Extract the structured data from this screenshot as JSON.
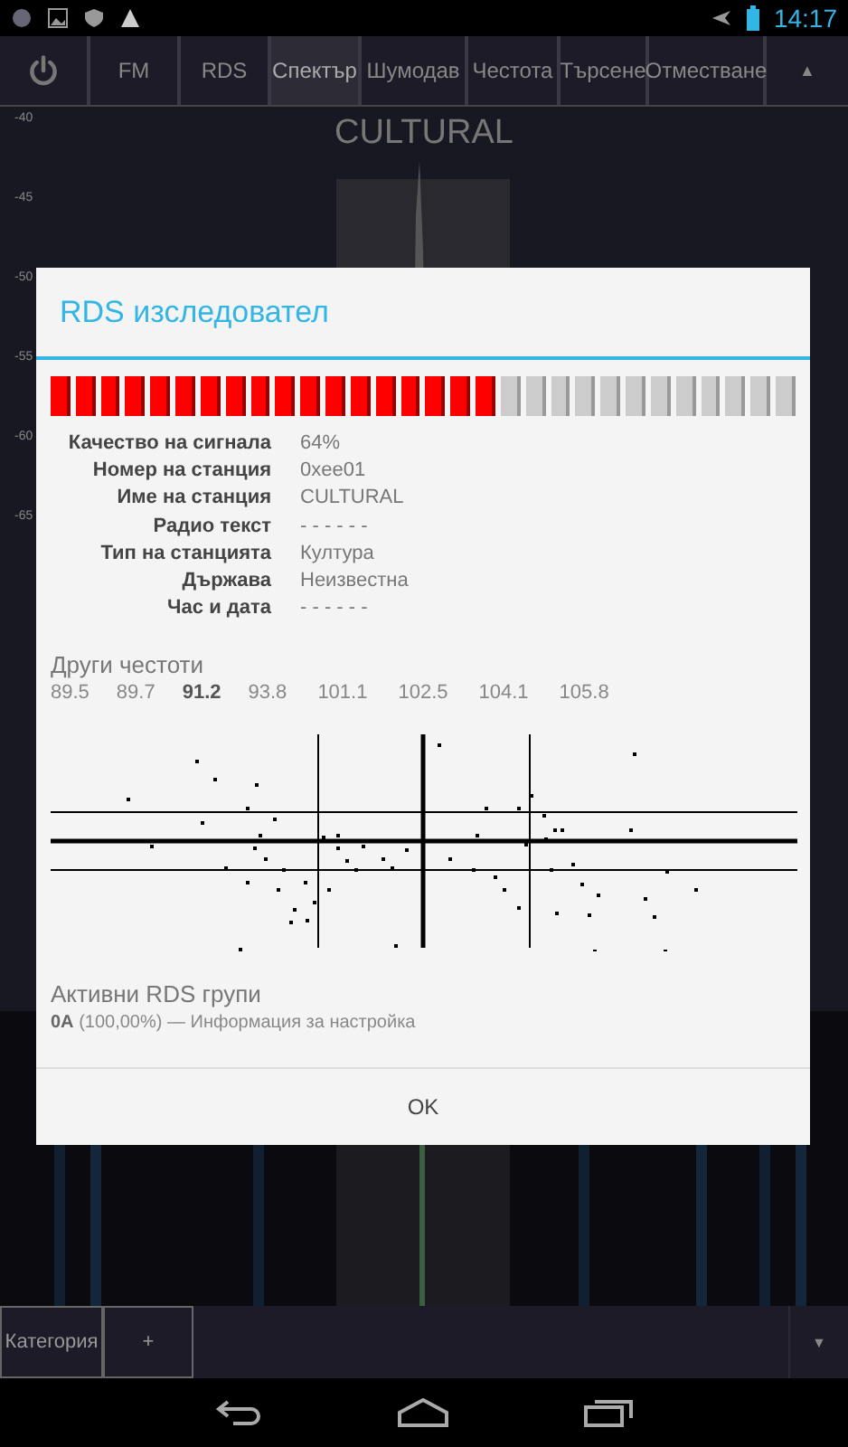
{
  "status_bar": {
    "time": "14:17"
  },
  "tabs": [
    {
      "kind": "power",
      "selected": false
    },
    {
      "kind": "text",
      "label": "FM",
      "selected": false
    },
    {
      "kind": "text",
      "label": "RDS",
      "selected": false
    },
    {
      "kind": "text",
      "label": "Спектър",
      "selected": true
    },
    {
      "kind": "text",
      "label": "Шумодав",
      "selected": false
    },
    {
      "kind": "text",
      "label": "Честота",
      "selected": false
    },
    {
      "kind": "text",
      "label": "Търсене",
      "selected": false
    },
    {
      "kind": "text",
      "label": "Отместване",
      "selected": false
    }
  ],
  "tab_scroll": "▲",
  "spectrum": {
    "station": "CULTURAL",
    "scale": [
      "-40",
      "-45",
      "-50",
      "-55",
      "-60",
      "-65"
    ]
  },
  "dialog": {
    "title": "RDS изследовател",
    "signal": {
      "level": 0.6
    },
    "info": [
      {
        "label": "Качество на сигнала",
        "value": "64%"
      },
      {
        "label": "Номер на станция",
        "value": "0xee01"
      },
      {
        "label": "Име на станция",
        "value": "CULTURAL"
      },
      {
        "label": "Радио текст",
        "value": "- - - - - -"
      },
      {
        "label": "Тип на станцията",
        "value": "Култура"
      },
      {
        "label": "Държава",
        "value": "Неизвестна"
      },
      {
        "label": "Час и дата",
        "value": "- - - - - -"
      }
    ],
    "other_frequencies_title": "Други честоти",
    "other_frequencies": [
      {
        "label": "89.5",
        "selected": false
      },
      {
        "label": "89.7",
        "selected": false
      },
      {
        "label": "91.2",
        "selected": true
      },
      {
        "label": "93.8",
        "selected": false
      },
      {
        "label": "101.1",
        "selected": false
      },
      {
        "label": "102.5",
        "selected": false
      },
      {
        "label": "104.1",
        "selected": false
      },
      {
        "label": "105.8",
        "selected": false
      }
    ],
    "groups_title": "Активни RDS групи",
    "groups": [
      "**0A** (100,00%) — Информация за настройка"
    ],
    "ok": "OK"
  },
  "bottom_bar": {
    "category": "Категория",
    "add": "+",
    "dropdown": "▼"
  }
}
